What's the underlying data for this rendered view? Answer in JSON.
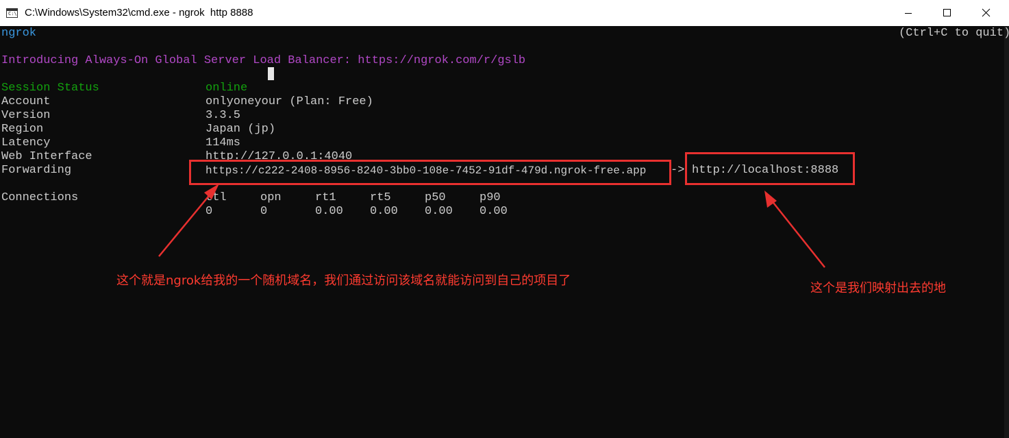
{
  "window": {
    "title": "C:\\Windows\\System32\\cmd.exe - ngrok  http 8888",
    "icon": "cmd-icon",
    "buttons": {
      "minimize": "minimize-icon",
      "maximize": "maximize-icon",
      "close": "close-icon"
    }
  },
  "terminal": {
    "app_name": "ngrok",
    "quit_hint": "(Ctrl+C to quit)",
    "intro": "Introducing Always-On Global Server Load Balancer: https://ngrok.com/r/gslb",
    "rows": [
      {
        "label": "Session Status",
        "value": "online"
      },
      {
        "label": "Account",
        "value": "onlyoneyour (Plan: Free)"
      },
      {
        "label": "Version",
        "value": "3.3.5"
      },
      {
        "label": "Region",
        "value": "Japan (jp)"
      },
      {
        "label": "Latency",
        "value": "114ms"
      },
      {
        "label": "Web Interface",
        "value": "http://127.0.0.1:4040"
      },
      {
        "label": "Forwarding",
        "value": "https://c222-2408-8956-8240-3bb0-108e-7452-91df-479d.ngrok-free.app",
        "arrow": "->",
        "target": "http://localhost:8888"
      }
    ],
    "connections": {
      "label": "Connections",
      "headers": [
        "ttl",
        "opn",
        "rt1",
        "rt5",
        "p50",
        "p90"
      ],
      "values": [
        "0",
        "0",
        "0.00",
        "0.00",
        "0.00",
        "0.00"
      ]
    }
  },
  "annotations": {
    "left_note": "这个就是ngrok给我的一个随机域名，我们通过访问该域名就能访问到自己的项目了",
    "right_note": "这个是我们映射出去的地",
    "color": "#e8302f"
  },
  "colors": {
    "background": "#0c0c0c",
    "text": "#cccccc",
    "intro": "#881798",
    "online": "#13a10e",
    "app_name": "#3a96dd"
  }
}
